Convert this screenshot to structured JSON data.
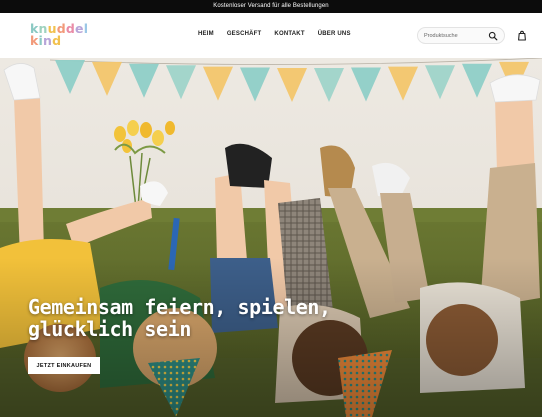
{
  "announcement": {
    "text": "Kostenloser Versand für alle Bestellungen"
  },
  "logo": {
    "line1": [
      "k",
      "n",
      "u",
      "d",
      "d",
      "e",
      "l"
    ],
    "line2": [
      "k",
      "i",
      "n",
      "d"
    ],
    "colors1": [
      "#8bc9c3",
      "#9ed2bf",
      "#f2c14f",
      "#f29a7a",
      "#e98ca7",
      "#b7a4d8",
      "#9bc7e6"
    ],
    "colors2": [
      "#f29a7a",
      "#8bc9c3",
      "#b7a4d8",
      "#f2c14f"
    ]
  },
  "nav": {
    "items": [
      "HEIM",
      "GESCHÄFT",
      "KONTAKT",
      "ÜBER UNS"
    ]
  },
  "search": {
    "placeholder": "Produktsuche",
    "value": ""
  },
  "hero": {
    "title": "Gemeinsam feiern, spielen, glücklich sein",
    "cta_label": "JETZT EINKAUFEN"
  },
  "colors": {
    "sofa": "#5d6b2b",
    "wall": "#ece8e1",
    "bunting": [
      "#8fcfc7",
      "#f3c66b",
      "#8fcfc7",
      "#9fd4c9",
      "#f3c66b",
      "#8fcfc7",
      "#f3c66b",
      "#9fd4c9",
      "#8fcfc7",
      "#f3c66b",
      "#9fd4c9",
      "#8fcfc7",
      "#f3c66b"
    ]
  }
}
